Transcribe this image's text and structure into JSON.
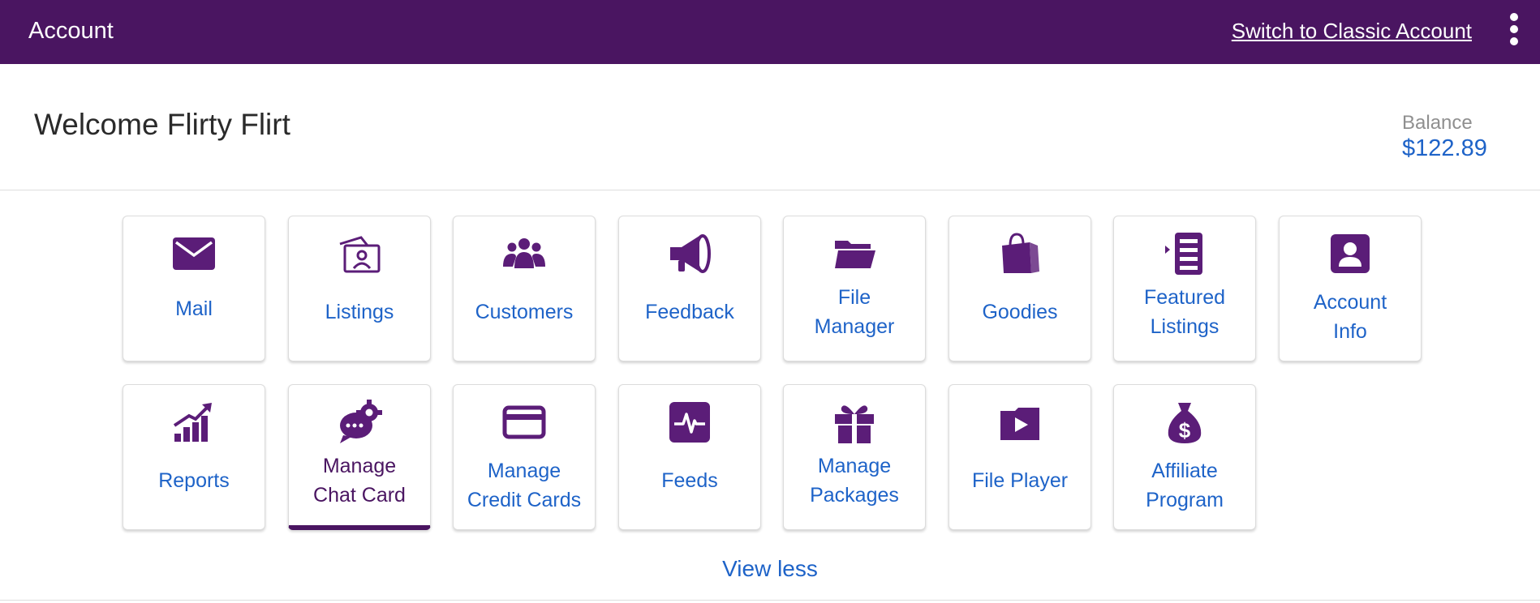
{
  "header": {
    "title": "Account",
    "switch_link": "Switch to Classic Account",
    "menu_icon": "more-vertical-icon"
  },
  "welcome": "Welcome Flirty Flirt",
  "balance": {
    "label": "Balance",
    "value": "$122.89"
  },
  "tiles": [
    {
      "label1": "Mail",
      "label2": "",
      "icon": "mail-icon"
    },
    {
      "label1": "Listings",
      "label2": "",
      "icon": "listings-icon"
    },
    {
      "label1": "Customers",
      "label2": "",
      "icon": "customers-icon"
    },
    {
      "label1": "Feedback",
      "label2": "",
      "icon": "megaphone-icon"
    },
    {
      "label1": "File",
      "label2": "Manager",
      "icon": "folder-icon"
    },
    {
      "label1": "Goodies",
      "label2": "",
      "icon": "shopping-bag-icon"
    },
    {
      "label1": "Featured",
      "label2": "Listings",
      "icon": "featured-list-icon"
    },
    {
      "label1": "Account",
      "label2": "Info",
      "icon": "account-box-icon"
    },
    {
      "label1": "Reports",
      "label2": "",
      "icon": "bar-chart-up-icon"
    },
    {
      "label1": "Manage",
      "label2": "Chat Card",
      "icon": "chat-gear-icon"
    },
    {
      "label1": "Manage",
      "label2": "Credit Cards",
      "icon": "credit-card-icon"
    },
    {
      "label1": "Feeds",
      "label2": "",
      "icon": "pulse-icon"
    },
    {
      "label1": "Manage",
      "label2": "Packages",
      "icon": "gift-icon"
    },
    {
      "label1": "File Player",
      "label2": "",
      "icon": "video-folder-icon"
    },
    {
      "label1": "Affiliate",
      "label2": "Program",
      "icon": "money-bag-icon"
    }
  ],
  "active_tile": "Manage Chat Card",
  "view_less": "View less",
  "colors": {
    "header_bg": "#4a1561",
    "icon": "#5b1d78",
    "link": "#1e63c8",
    "active": "#4a1561"
  }
}
